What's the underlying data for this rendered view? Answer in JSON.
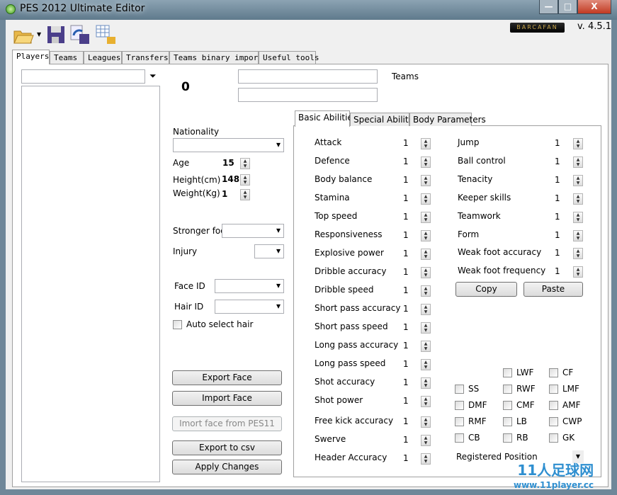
{
  "window": {
    "title": "PES 2012 Ultimate Editor",
    "minimize": "—",
    "maximize": "□",
    "close": "X"
  },
  "toolbar": {
    "icons": [
      "open-folder-icon",
      "save-icon",
      "save-as-icon",
      "database-export-icon"
    ],
    "logo": "BARCAFAN",
    "version": "v. 4.5.1"
  },
  "tabs": [
    "Players",
    "Teams",
    "Leagues",
    "Transfers",
    "Teams binary import",
    "Useful tools"
  ],
  "active_tab": "Players",
  "players": {
    "search": {
      "value": "",
      "placeholder": ""
    },
    "count": "0",
    "teams_label": "Teams",
    "nationality_label": "Nationality",
    "age_label": "Age",
    "age": "15",
    "height_label": "Height(cm)",
    "height": "148",
    "weight_label": "Weight(Kg)",
    "weight": "1",
    "stronger_foot_label": "Stronger foot",
    "injury_label": "Injury",
    "face_id_label": "Face ID",
    "hair_id_label": "Hair ID",
    "auto_select_hair": "Auto select hair",
    "buttons": {
      "export_face": "Export Face",
      "import_face": "Import Face",
      "import_pes11": "Imort face from PES11",
      "export_csv": "Export to csv",
      "apply": "Apply Changes"
    }
  },
  "inner_tabs": [
    "Basic Abilities",
    "Special Abilities",
    "Body Parameters"
  ],
  "abilities_left": [
    {
      "label": "Attack",
      "value": "1"
    },
    {
      "label": "Defence",
      "value": "1"
    },
    {
      "label": "Body balance",
      "value": "1"
    },
    {
      "label": "Stamina",
      "value": "1"
    },
    {
      "label": "Top speed",
      "value": "1"
    },
    {
      "label": "Responsiveness",
      "value": "1"
    },
    {
      "label": "Explosive power",
      "value": "1"
    },
    {
      "label": "Dribble accuracy",
      "value": "1"
    },
    {
      "label": "Dribble speed",
      "value": "1"
    },
    {
      "label": "Short pass accuracy",
      "value": "1"
    },
    {
      "label": "Short pass speed",
      "value": "1"
    },
    {
      "label": "Long pass accuracy",
      "value": "1"
    },
    {
      "label": "Long pass speed",
      "value": "1"
    },
    {
      "label": "Shot accuracy",
      "value": "1"
    },
    {
      "label": "Shot power",
      "value": "1"
    },
    {
      "label": "Free kick accuracy",
      "value": "1"
    },
    {
      "label": "Swerve",
      "value": "1"
    },
    {
      "label": "Header Accuracy",
      "value": "1"
    }
  ],
  "abilities_right": [
    {
      "label": "Jump",
      "value": "1"
    },
    {
      "label": "Ball control",
      "value": "1"
    },
    {
      "label": "Tenacity",
      "value": "1"
    },
    {
      "label": "Keeper skills",
      "value": "1"
    },
    {
      "label": "Teamwork",
      "value": "1"
    },
    {
      "label": "Form",
      "value": "1"
    },
    {
      "label": "Weak foot accuracy",
      "value": "1"
    },
    {
      "label": "Weak foot frequency",
      "value": "1"
    }
  ],
  "copy": "Copy",
  "paste": "Paste",
  "positions": [
    [
      "",
      "LWF",
      "CF"
    ],
    [
      "SS",
      "RWF",
      "LMF"
    ],
    [
      "DMF",
      "CMF",
      "AMF"
    ],
    [
      "RMF",
      "LB",
      "CWP"
    ],
    [
      "CB",
      "RB",
      "GK"
    ]
  ],
  "registered_position": "Registered Position",
  "watermark": "11人足球网 www.11player.cc"
}
